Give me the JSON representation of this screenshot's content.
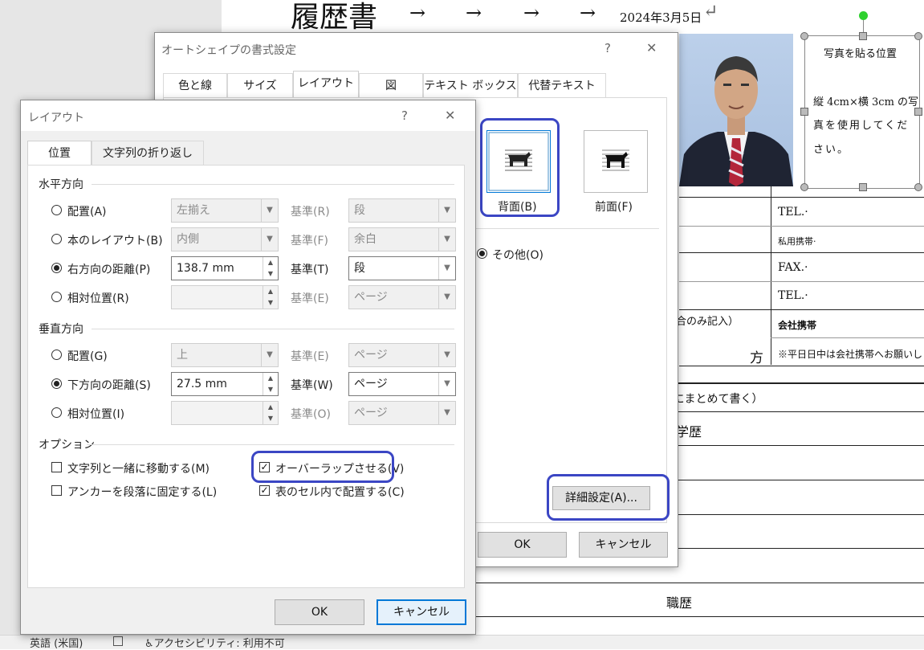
{
  "document": {
    "title": "履歴書",
    "arrows": [
      "→",
      "→",
      "→",
      "→"
    ],
    "date": "2024年3月5日",
    "photo_box": {
      "line1": "写真を貼る位置",
      "line2": "縦 4cm×横 3cm の写",
      "line3": "真を使用してくだ",
      "line4": "さい。"
    },
    "cells": {
      "tel1": "TEL.·",
      "private_mobile": "私用携帯·",
      "fax": "FAX.·",
      "tel2": "TEL.·",
      "company_mobile": "会社携帯",
      "note_only": "合のみ記入）",
      "kata": "方",
      "weekday_note": "※平日日中は会社携帯へお願いしま",
      "summary_note": "]にまとめて書く）",
      "gakureki": "学歴",
      "shokureki": "職歴"
    },
    "para_mark": "↵"
  },
  "statusbar": {
    "language": "英語 (米国)",
    "accessibility": "アクセシビリティ: 利用不可"
  },
  "format_dialog": {
    "title": "オートシェイプの書式設定",
    "help": "?",
    "close": "✕",
    "tabs": [
      "色と線",
      "サイズ",
      "レイアウト",
      "図",
      "テキスト ボックス",
      "代替テキスト"
    ],
    "active_tab": "レイアウト",
    "wrap_behind_label": "背面(B)",
    "wrap_front_label": "前面(F)",
    "other_label": "その他(O)",
    "advanced_button": "詳細設定(A)...",
    "ok": "OK",
    "cancel": "キャンセル"
  },
  "layout_dialog": {
    "title": "レイアウト",
    "help": "?",
    "close": "✕",
    "tabs": [
      "位置",
      "文字列の折り返し"
    ],
    "horizontal": {
      "heading": "水平方向",
      "rows": [
        {
          "label": "配置(A)",
          "checked": false,
          "value": "左揃え",
          "base_label": "基準(R)",
          "base": "段",
          "enabled": false
        },
        {
          "label": "本のレイアウト(B)",
          "checked": false,
          "value": "内側",
          "base_label": "基準(F)",
          "base": "余白",
          "enabled": false
        },
        {
          "label": "右方向の距離(P)",
          "checked": true,
          "value": "138.7 mm",
          "base_label": "基準(T)",
          "base": "段",
          "enabled": true
        },
        {
          "label": "相対位置(R)",
          "checked": false,
          "value": "",
          "base_label": "基準(E)",
          "base": "ページ",
          "enabled": false
        }
      ]
    },
    "vertical": {
      "heading": "垂直方向",
      "rows": [
        {
          "label": "配置(G)",
          "checked": false,
          "value": "上",
          "base_label": "基準(E)",
          "base": "ページ",
          "enabled": false
        },
        {
          "label": "下方向の距離(S)",
          "checked": true,
          "value": "27.5 mm",
          "base_label": "基準(W)",
          "base": "ページ",
          "enabled": true
        },
        {
          "label": "相対位置(I)",
          "checked": false,
          "value": "",
          "base_label": "基準(O)",
          "base": "ページ",
          "enabled": false
        }
      ]
    },
    "options": {
      "heading": "オプション",
      "move_with_text": "文字列と一緒に移動する(M)",
      "lock_anchor": "アンカーを段落に固定する(L)",
      "allow_overlap": "オーバーラップさせる(V)",
      "layout_in_cell": "表のセル内で配置する(C)"
    },
    "ok": "OK",
    "cancel": "キャンセル"
  },
  "highlight_color": "#3b46c4"
}
